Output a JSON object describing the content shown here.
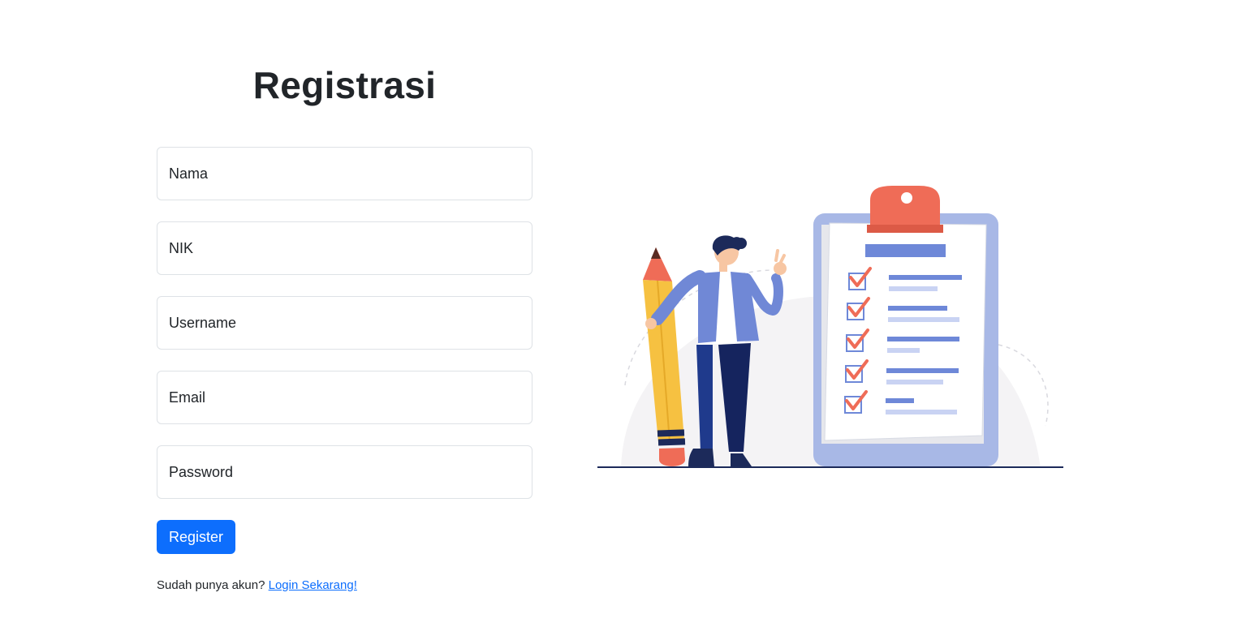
{
  "page": {
    "title": "Registrasi"
  },
  "form": {
    "fields": [
      {
        "name": "nama",
        "placeholder": "Nama",
        "value": ""
      },
      {
        "name": "nik",
        "placeholder": "NIK",
        "value": ""
      },
      {
        "name": "username",
        "placeholder": "Username",
        "value": ""
      },
      {
        "name": "email",
        "placeholder": "Email",
        "value": ""
      },
      {
        "name": "password",
        "placeholder": "Password",
        "value": ""
      }
    ],
    "submit_label": "Register"
  },
  "footer": {
    "prompt": "Sudah punya akun?",
    "link_label": "Login Sekarang!"
  },
  "colors": {
    "primary": "#0d6efd",
    "border": "#dee2e6",
    "text": "#212529",
    "illustration_accent": "#ef6c57",
    "illustration_blue": "#7088d6"
  },
  "illustration": {
    "icon": "registration-clipboard-illustration"
  }
}
